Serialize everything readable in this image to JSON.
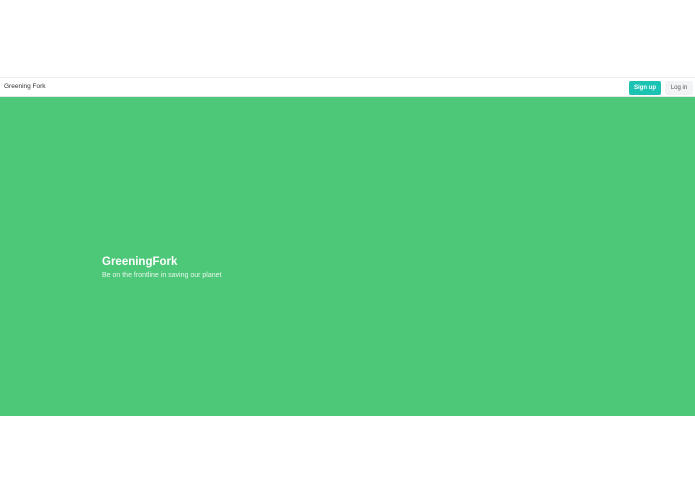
{
  "navbar": {
    "brand": "Greening Fork",
    "signup_label": "Sign up",
    "login_label": "Log in"
  },
  "hero": {
    "title": "GreeningFork",
    "subtitle": "Be on the frontline in saving our planet"
  },
  "colors": {
    "hero_background": "#4cc878",
    "signup_button": "#1cc3b2",
    "login_button": "#f2f3f4"
  }
}
